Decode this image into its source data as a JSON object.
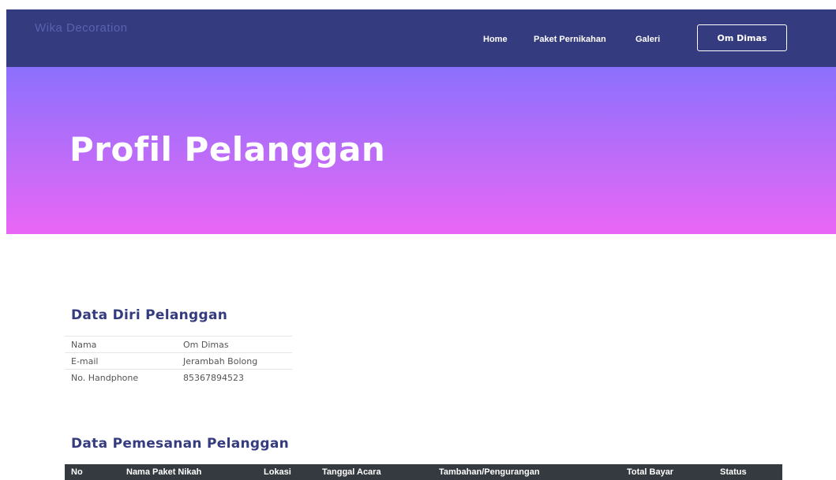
{
  "nav": {
    "brand": "Wika Decoration",
    "links": [
      "Home",
      "Paket Pernikahan",
      "Galeri"
    ],
    "user_button": "Om Dimas"
  },
  "hero": {
    "title": "Profil Pelanggan"
  },
  "profile": {
    "title": "Data Diri Pelanggan",
    "rows": [
      {
        "label": "Nama",
        "value": "Om Dimas"
      },
      {
        "label": "E-mail",
        "value": "Jerambah Bolong"
      },
      {
        "label": "No. Handphone",
        "value": "85367894523"
      }
    ]
  },
  "orders": {
    "title": "Data Pemesanan Pelanggan",
    "headers": [
      "No",
      "Nama Paket Nikah",
      "Lokasi",
      "Tanggal Acara",
      "Tambahan/Pengurangan",
      "Total Bayar",
      "Status"
    ]
  },
  "colors": {
    "navbar": "#343b7e",
    "hero_top": "#8b70fd",
    "hero_bottom": "#ea66f6",
    "heading": "#343b7e",
    "table_header": "#343a40"
  }
}
